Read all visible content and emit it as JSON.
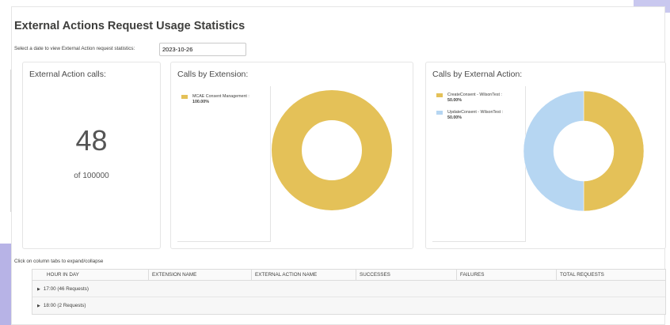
{
  "title": "External Actions Request Usage Statistics",
  "date_label": "Select a date to view External Action request statistics:",
  "date_value": "2023-10-26",
  "calls_panel": {
    "title": "External Action calls:",
    "count": "48",
    "limit": "of 100000"
  },
  "extension_panel": {
    "title": "Calls by Extension:",
    "legend": [
      {
        "name": "MCAE Consent Management :",
        "pct": "100.00%"
      }
    ]
  },
  "action_panel": {
    "title": "Calls by External Action:",
    "legend": [
      {
        "name": "CreateConsent - WilsonTest :",
        "pct": "50.00%"
      },
      {
        "name": "UpdateConsent - WilsonTest :",
        "pct": "50.00%"
      }
    ]
  },
  "chart_data": [
    {
      "type": "pie",
      "title": "Calls by Extension:",
      "categories": [
        "MCAE Consent Management"
      ],
      "values": [
        100.0
      ],
      "colors": [
        "#e4c158"
      ]
    },
    {
      "type": "pie",
      "title": "Calls by External Action:",
      "categories": [
        "CreateConsent - WilsonTest",
        "UpdateConsent - WilsonTest"
      ],
      "values": [
        50.0,
        50.0
      ],
      "colors": [
        "#e4c158",
        "#b6d6f2"
      ]
    }
  ],
  "hint": "Click on column tabs to expand/collapse",
  "table": {
    "columns": [
      "HOUR IN DAY",
      "EXTENSION NAME",
      "EXTERNAL ACTION NAME",
      "SUCCESSES",
      "FAILURES",
      "TOTAL REQUESTS"
    ],
    "rows": [
      "17:00 (46 Requests)",
      "18:00 (2 Requests)"
    ]
  },
  "colors": {
    "gold": "#e4c158",
    "lightblue": "#b6d6f2"
  }
}
